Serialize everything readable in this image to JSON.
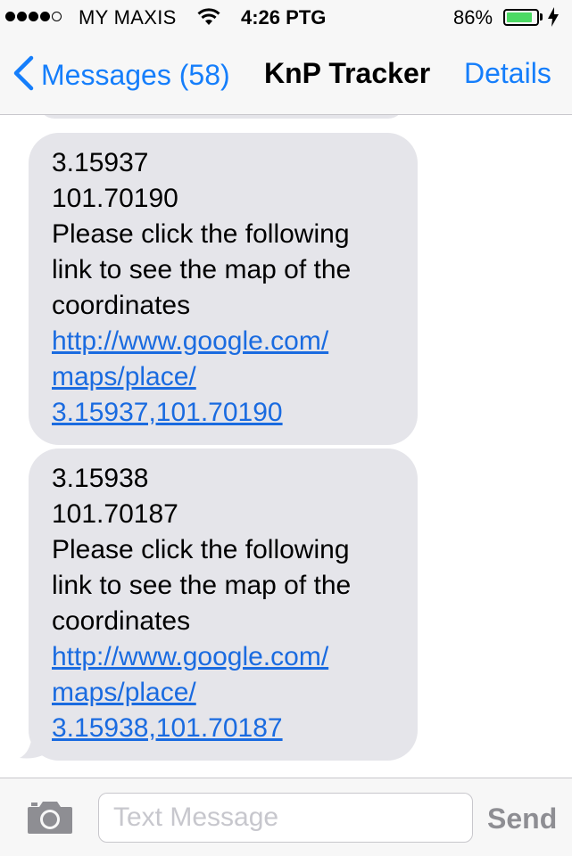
{
  "status_bar": {
    "carrier": "MY MAXIS",
    "time": "4:26 PTG",
    "battery_percent": "86%",
    "battery_level": 0.86,
    "signal_bars": 4,
    "signal_total": 5
  },
  "nav": {
    "back_label": "Messages (58)",
    "title": "KnP Tracker",
    "details_label": "Details"
  },
  "messages": [
    {
      "latitude": "3.15937",
      "longitude": "101.70190",
      "text_lines": [
        "Please click the following",
        "link to see the map of the",
        "coordinates"
      ],
      "link_lines": [
        "http://www.google.com/",
        "maps/place/",
        "3.15937,101.70190"
      ]
    },
    {
      "latitude": "3.15938",
      "longitude": "101.70187",
      "text_lines": [
        "Please click the following",
        "link to see the map of the",
        "coordinates"
      ],
      "link_lines": [
        "http://www.google.com/",
        "maps/place/",
        "3.15938,101.70187"
      ]
    }
  ],
  "composer": {
    "placeholder": "Text Message",
    "send_label": "Send"
  },
  "icons": [
    "back-chevron-icon",
    "wifi-icon",
    "battery-icon",
    "charging-bolt-icon",
    "camera-icon"
  ],
  "colors": {
    "accent": "#157efb",
    "bubble": "#e5e5ea",
    "link": "#1a6be0",
    "battery": "#4cd964"
  }
}
